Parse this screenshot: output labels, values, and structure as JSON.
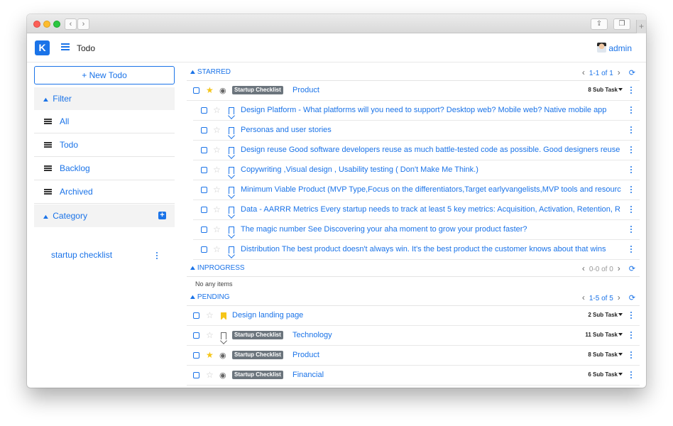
{
  "appbar": {
    "title": "Todo",
    "user": "admin",
    "logo": "K"
  },
  "sidebar": {
    "new_todo": "+ New Todo",
    "filter_label": "Filter",
    "filters": [
      {
        "label": "All"
      },
      {
        "label": "Todo"
      },
      {
        "label": "Backlog"
      },
      {
        "label": "Archived"
      }
    ],
    "category_label": "Category",
    "categories": [
      {
        "label": "startup checklist"
      }
    ]
  },
  "sections": {
    "starred": {
      "title": "STARRED",
      "pager": "1-1 of 1",
      "rows": [
        {
          "badge": "Startup Checklist",
          "text": "Product",
          "subtasks": "8 Sub Task",
          "starred": true
        }
      ],
      "subrows": [
        {
          "text": "Design Platform - What platforms will you need to support? Desktop web? Mobile web? Native mobile app"
        },
        {
          "text": "Personas and user stories"
        },
        {
          "text": "Design reuse Good software developers reuse as much battle-tested code as possible. Good designers reuse"
        },
        {
          "text": "Copywriting ,Visual design , Usability testing ( Don't Make Me Think.)"
        },
        {
          "text": "Minimum Viable Product (MVP Type,Focus on the differentiators,Target earlyvangelists,MVP tools and resourc"
        },
        {
          "text": "Data - AARRR Metrics Every startup needs to track at least 5 key metrics: Acquisition, Activation, Retention, R"
        },
        {
          "text": "The magic number See Discovering your aha moment to grow your product faster?"
        },
        {
          "text": "Distribution The best product doesn't always win. It's the best product the customer knows about that wins"
        }
      ]
    },
    "inprogress": {
      "title": "INPROGRESS",
      "pager": "0-0 of 0",
      "empty": "No any items"
    },
    "pending": {
      "title": "PENDING",
      "pager": "1-5 of 5",
      "rows": [
        {
          "badge": "",
          "text": "Design landing page",
          "subtasks": "2 Sub Task"
        },
        {
          "badge": "Startup Checklist",
          "text": "Technology",
          "subtasks": "11 Sub Task"
        },
        {
          "badge": "Startup Checklist",
          "text": "Product",
          "subtasks": "8 Sub Task"
        },
        {
          "badge": "Startup Checklist",
          "text": "Financial",
          "subtasks": "6 Sub Task"
        }
      ]
    }
  },
  "colors": {
    "accent": "#1a73e8",
    "star": "#f5c518",
    "badge": "#6c757d"
  }
}
